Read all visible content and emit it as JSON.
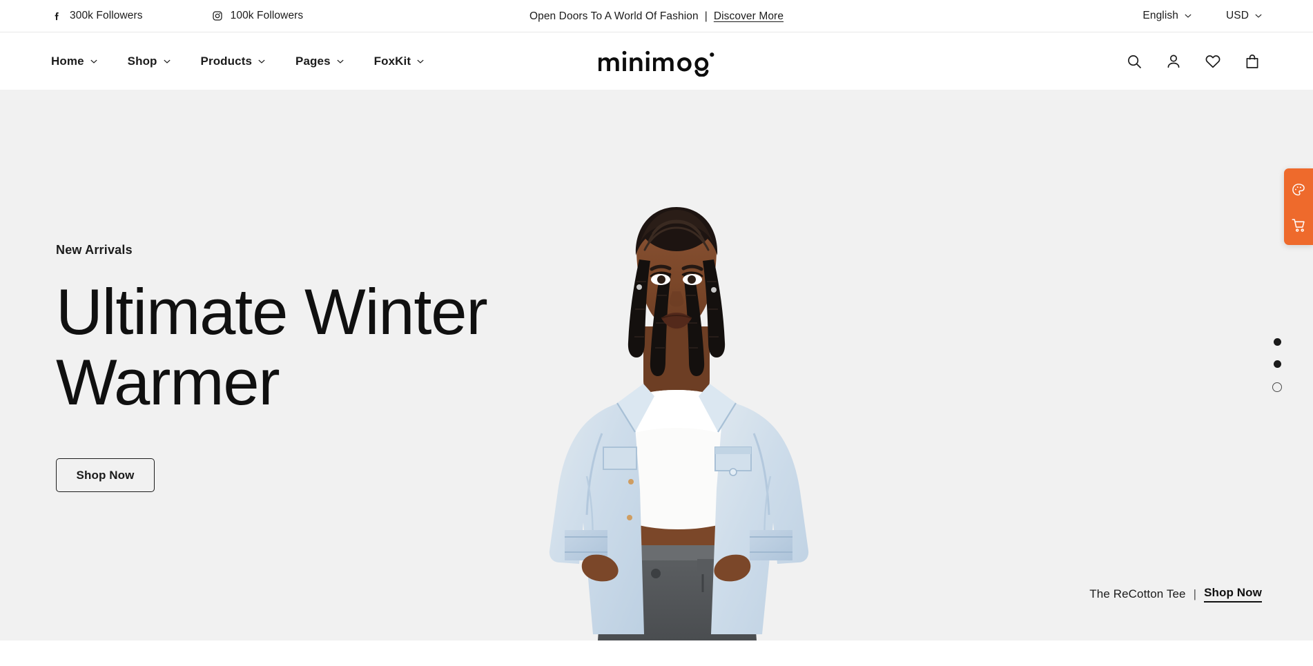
{
  "announcement": {
    "social": [
      {
        "icon": "facebook-icon",
        "label": "300k Followers"
      },
      {
        "icon": "instagram-icon",
        "label": "100k Followers"
      }
    ],
    "message": "Open Doors To A World Of Fashion",
    "separator": "|",
    "link_label": "Discover More",
    "language": "English",
    "currency": "USD"
  },
  "header": {
    "logo_text": "minimog",
    "nav": [
      {
        "label": "Home",
        "has_dropdown": true
      },
      {
        "label": "Shop",
        "has_dropdown": true
      },
      {
        "label": "Products",
        "has_dropdown": true
      },
      {
        "label": "Pages",
        "has_dropdown": true
      },
      {
        "label": "FoxKit",
        "has_dropdown": true
      }
    ],
    "actions": [
      {
        "icon": "search-icon",
        "label": "Search"
      },
      {
        "icon": "user-icon",
        "label": "Account"
      },
      {
        "icon": "heart-icon",
        "label": "Wishlist"
      },
      {
        "icon": "shopping-bag-icon",
        "label": "Cart"
      }
    ]
  },
  "hero": {
    "eyebrow": "New Arrivals",
    "title": "Ultimate Winter\nWarmer",
    "cta_label": "Shop Now",
    "product_name": "The ReCotton Tee",
    "product_separator": "|",
    "product_cta": "Shop Now",
    "slides": [
      {
        "index": 1,
        "active": false
      },
      {
        "index": 2,
        "active": false
      },
      {
        "index": 3,
        "active": true
      }
    ],
    "background_color": "#f1f1f1"
  },
  "floating_tools": {
    "accent_color": "#ee6a2c",
    "buttons": [
      {
        "icon": "palette-icon",
        "label": "Theme settings"
      },
      {
        "icon": "cart-icon",
        "label": "Cart"
      }
    ]
  }
}
